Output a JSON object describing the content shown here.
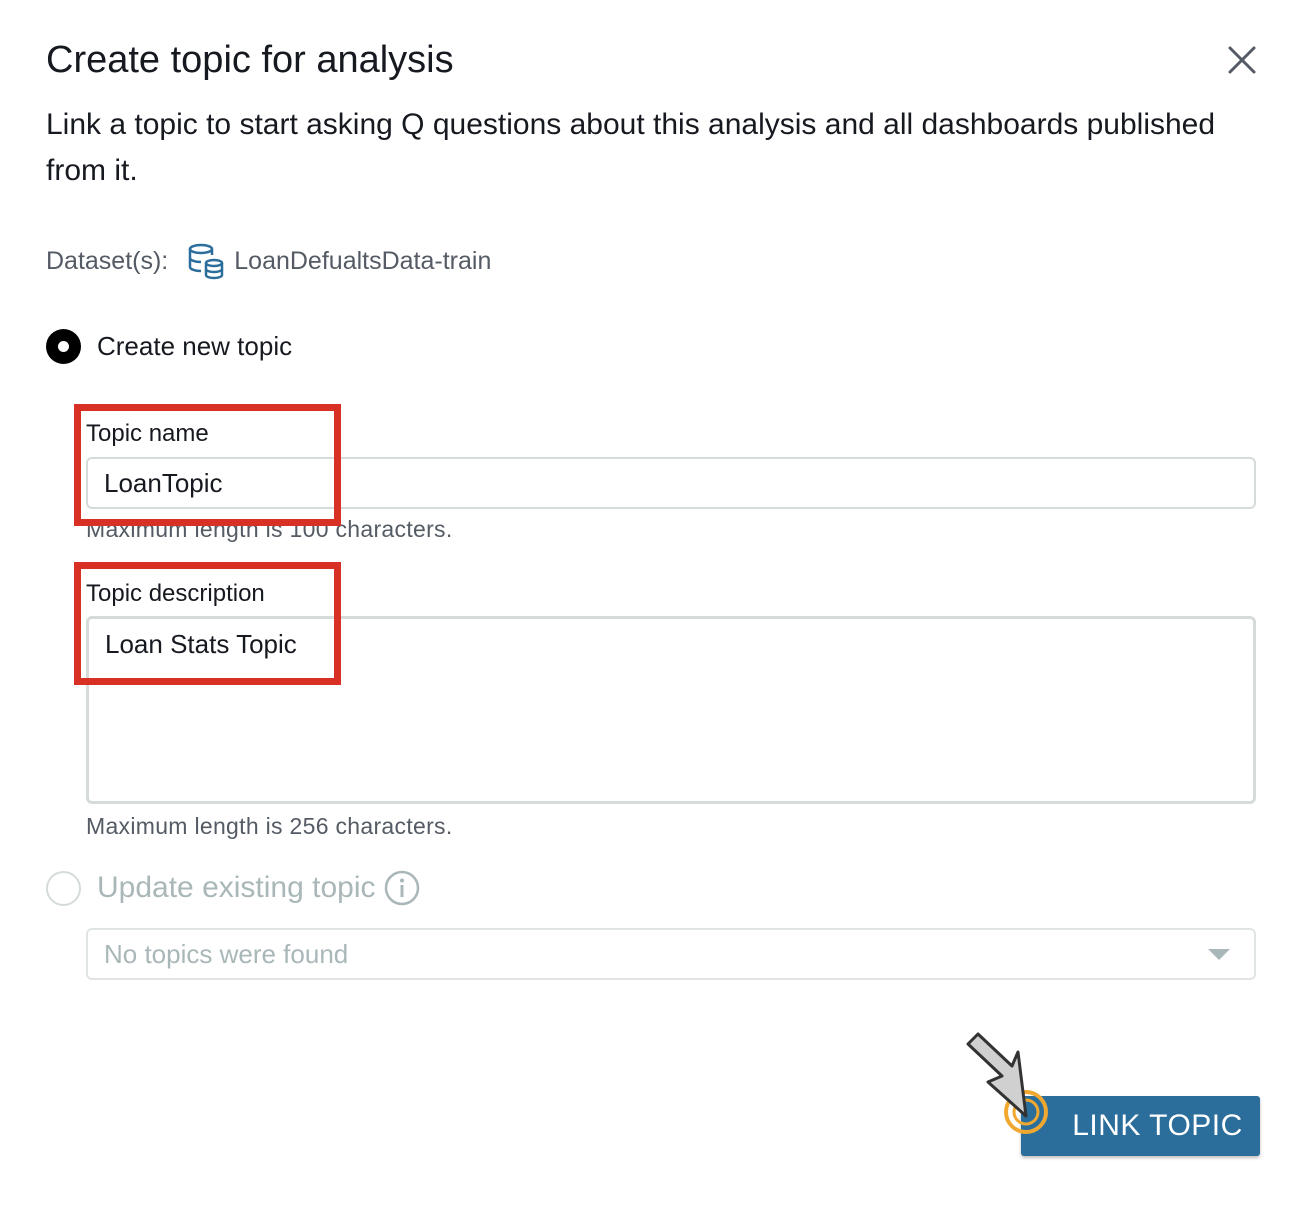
{
  "dialog": {
    "title": "Create topic for analysis",
    "subtitle": "Link a topic to start asking Q questions about this analysis and all dashboards published from it.",
    "close_icon": "close-icon"
  },
  "dataset": {
    "label": "Dataset(s):",
    "icon": "database-icon",
    "name": "LoanDefualtsData-train"
  },
  "create_option": {
    "label": "Create new topic",
    "selected": true
  },
  "topic_name": {
    "label": "Topic name",
    "value": "LoanTopic",
    "hint": "Maximum length is 100 characters."
  },
  "topic_description": {
    "label": "Topic description",
    "value": "Loan Stats Topic",
    "hint": "Maximum length is 256 characters."
  },
  "update_option": {
    "label": "Update existing topic",
    "selected": false,
    "disabled": true,
    "info_icon": "info-icon"
  },
  "existing_topic_select": {
    "placeholder": "No topics were found"
  },
  "actions": {
    "link_label": "LINK TOPIC"
  },
  "colors": {
    "primary_button": "#2c6e9b",
    "highlight": "#d93025",
    "cursor_ring": "#f0a830"
  }
}
